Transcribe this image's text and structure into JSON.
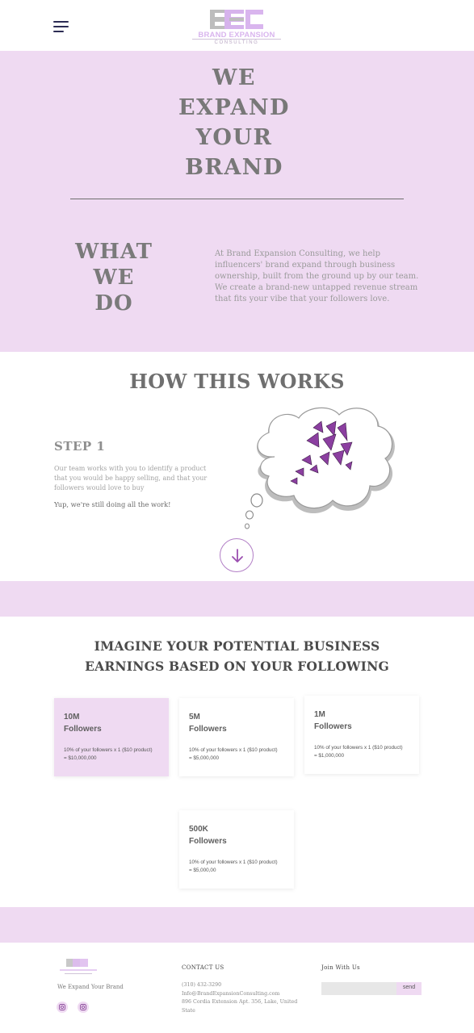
{
  "header": {
    "logo_name": "BRAND EXPANSION",
    "logo_sub": "CONSULTING"
  },
  "hero": {
    "title_lines": [
      "WE",
      "EXPAND",
      "YOUR",
      "BRAND"
    ],
    "what_lines": [
      "WHAT",
      "WE",
      "DO"
    ],
    "what_text": "At Brand Expansion Consulting, we help influencers' brand expand through business ownership, built from the ground up by our team. We create a brand-new untapped revenue stream that fits your vibe that your followers love."
  },
  "how": {
    "title": "HOW THIS WORKS",
    "step_title": "STEP 1",
    "step_desc": "Our team works with you to identify a product that you would be happy selling, and that your followers would love to buy",
    "step_note": "Yup, we're still doing all the work!"
  },
  "earnings": {
    "title_lines": [
      "IMAGINE YOUR POTENTIAL BUSINESS",
      "EARNINGS BASED ON YOUR FOLLOWING"
    ],
    "cards": [
      {
        "amount": "10M",
        "label": "Followers",
        "calc_line1": "10% of your followers x 1 ($10 product)",
        "calc_line2": "= $10,000,000"
      },
      {
        "amount": "5M",
        "label": "Followers",
        "calc_line1": "10% of your followers x 1 ($10 product)",
        "calc_line2": "= $5,000,000"
      },
      {
        "amount": "1M",
        "label": "Followers",
        "calc_line1": "10% of your followers x 1 ($10 product)",
        "calc_line2": "= $1,000,000"
      },
      {
        "amount": "500K",
        "label": "Followers",
        "calc_line1": "10% of your followers x 1 ($10 product)",
        "calc_line2": "= $5,000,00"
      }
    ]
  },
  "footer": {
    "tagline": "We Expand Your Brand",
    "contact_heading": "CONTACT US",
    "phone": "(310) 432-3290",
    "email": "Info@BrandExpansionConsulting.com",
    "address": "896 Cordia Extension Apt. 356, Lake, United State",
    "join_heading": "Join With Us",
    "email_placeholder": "",
    "send_label": "send"
  },
  "colors": {
    "lavender": "#efdaf2",
    "butterfly_purple": "#8b3fa0",
    "text_gray": "#7a7a7a"
  },
  "icons": [
    "menu-icon",
    "brand-logo",
    "butterflies-illustration",
    "arrow-down-icon",
    "instagram-icon"
  ]
}
